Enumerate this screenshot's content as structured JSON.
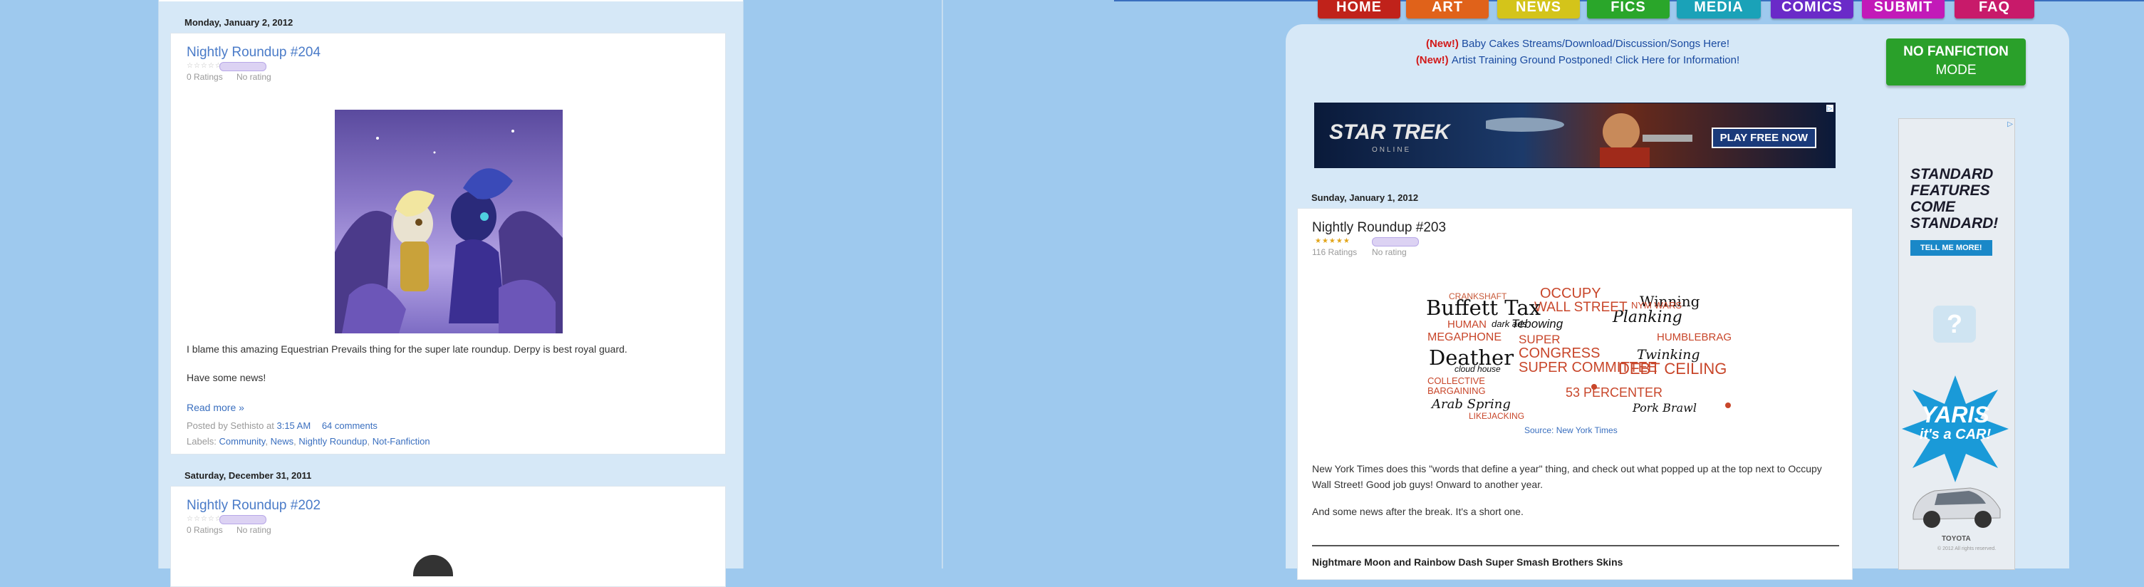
{
  "left": {
    "post1": {
      "date": "Monday, January 2, 2012",
      "title": "Nightly Roundup #204",
      "ratings": "0 Ratings",
      "rating_status": "No rating",
      "text1": "I blame this amazing Equestrian Prevails thing for the super late roundup.  Derpy is best royal guard.",
      "text2": "Have some news!",
      "read_more": "Read more »",
      "posted_by_prefix": "Posted by Sethisto at",
      "time": "3:15 AM",
      "comments": "64 comments",
      "labels_prefix": "Labels:",
      "labels": [
        "Community",
        "News",
        "Nightly Roundup",
        "Not-Fanfiction"
      ]
    },
    "post2": {
      "date": "Saturday, December 31, 2011",
      "title": "Nightly Roundup #202",
      "ratings": "0 Ratings",
      "rating_status": "No rating"
    }
  },
  "right": {
    "nav": [
      {
        "label": "HOME",
        "color": "#c0221a"
      },
      {
        "label": "ART",
        "color": "#e0621a"
      },
      {
        "label": "NEWS",
        "color": "#d4c41a"
      },
      {
        "label": "FICS",
        "color": "#2aa62a"
      },
      {
        "label": "MEDIA",
        "color": "#1aa2b8"
      },
      {
        "label": "COMICS",
        "color": "#6a2ac8"
      },
      {
        "label": "SUBMIT",
        "color": "#c21ab8"
      },
      {
        "label": "FAQ",
        "color": "#c81a6a"
      }
    ],
    "announce": [
      {
        "new": "(New!)",
        "text": "Baby Cakes Streams/Download/Discussion/Songs Here!"
      },
      {
        "new": "(New!)",
        "text": "Artist Training Ground Postponed! Click Here for Information!"
      }
    ],
    "mode_btn": {
      "line1": "NO FANFICTION",
      "line2": "MODE"
    },
    "banner_ad": {
      "brand": "STAR TREK",
      "sub": "ONLINE",
      "cta": "PLAY FREE NOW"
    },
    "post": {
      "date": "Sunday, January 1, 2012",
      "title": "Nightly Roundup #203",
      "ratings": "116 Ratings",
      "rating_status": "No rating",
      "source": "Source: New York Times",
      "text1": "New York Times does this \"words that define a year\" thing, and check out what popped up at the top next to Occupy Wall Street! Good job guys! Onward to another year.",
      "text2": "And some news after the break.  It's a short one.",
      "next_heading": "Nightmare Moon and Rainbow Dash Super Smash Brothers Skins"
    },
    "side_ad": {
      "headline": [
        "STANDARD",
        "FEATURES",
        "COME",
        "STANDARD!"
      ],
      "cta": "TELL ME MORE!",
      "car": [
        "YARIS",
        "it's a CAR!"
      ],
      "brand": "TOYOTA",
      "fine": "© 2012 All rights reserved."
    },
    "wordcloud": [
      "CRANKSHAFT",
      "OCCUPY",
      "Planking",
      "WALL STREET",
      "Winning",
      "Buffett Tax",
      "HUMAN",
      "MEGAPHONE",
      "Tebowing",
      "NYM WARS",
      "HUMBLEBRAG",
      "Deather",
      "SUPER",
      "CONGRESS",
      "COLLECTIVE",
      "BARGAINING",
      "SUPER COMMITTEE",
      "DEBT CEILING",
      "Arab Spring",
      "53 PERCENTER",
      "LIKEJACKING",
      "cloud house",
      "Twinking",
      "Pork Brawl",
      "dark ads"
    ]
  }
}
